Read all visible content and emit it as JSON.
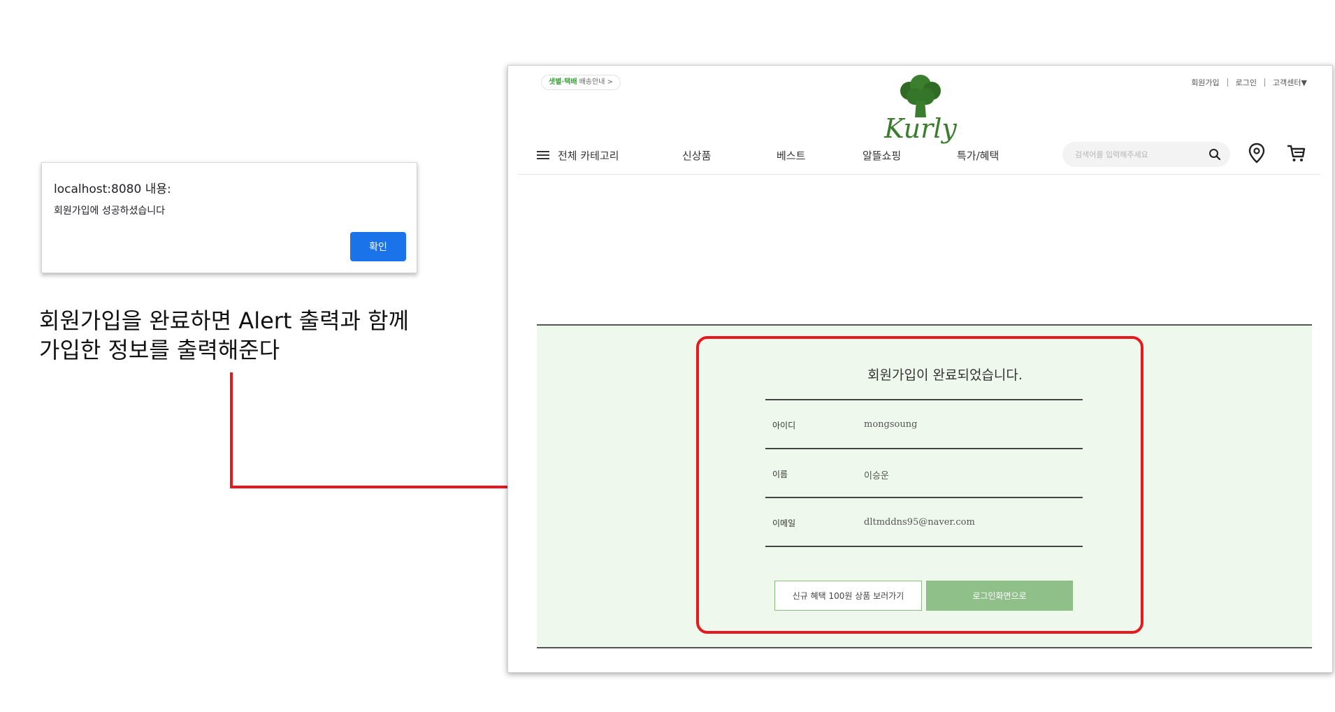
{
  "alert": {
    "title": "localhost:8080 내용:",
    "message": "회원가입에 성공하셨습니다",
    "ok_label": "확인"
  },
  "annotation": {
    "line1": "회원가입을 완료하면 Alert 출력과 함께",
    "line2": "가입한 정보를 출력해준다",
    "color": "#e8191e"
  },
  "site": {
    "delivery_badge": {
      "emphasis": "샛별·택배",
      "text": "배송안내 >"
    },
    "util_nav": [
      "회원가입",
      "로그인",
      "고객센터▼"
    ],
    "logo_text": "Kurly",
    "logo_icon": "broccoli-icon",
    "gnb": {
      "all_category": "전체 카테고리",
      "items": [
        "신상품",
        "베스트",
        "알뜰쇼핑",
        "특가/혜택"
      ]
    },
    "search": {
      "placeholder": "검색어를 입력해주세요"
    },
    "result": {
      "title": "회원가입이 완료되었습니다.",
      "rows": [
        {
          "label": "아이디",
          "value": "mongsoung"
        },
        {
          "label": "이름",
          "value": "이승운"
        },
        {
          "label": "이메일",
          "value": "dltmddns95@naver.com"
        }
      ],
      "buttons": {
        "benefit": "신규 혜택 100원 상품 보러가기",
        "login": "로그인화면으로"
      }
    },
    "colors": {
      "brand_green": "#3a7d2c",
      "panel_bg": "#eff8ec",
      "button_green": "#8fc08a"
    }
  }
}
